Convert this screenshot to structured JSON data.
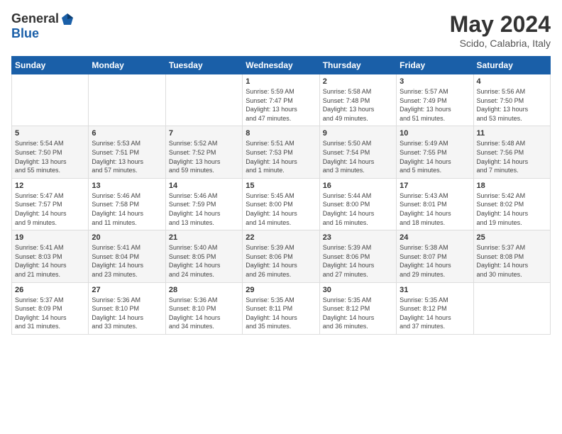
{
  "header": {
    "logo_general": "General",
    "logo_blue": "Blue",
    "month_year": "May 2024",
    "location": "Scido, Calabria, Italy"
  },
  "weekdays": [
    "Sunday",
    "Monday",
    "Tuesday",
    "Wednesday",
    "Thursday",
    "Friday",
    "Saturday"
  ],
  "weeks": [
    [
      {
        "day": "",
        "info": ""
      },
      {
        "day": "",
        "info": ""
      },
      {
        "day": "",
        "info": ""
      },
      {
        "day": "1",
        "info": "Sunrise: 5:59 AM\nSunset: 7:47 PM\nDaylight: 13 hours\nand 47 minutes."
      },
      {
        "day": "2",
        "info": "Sunrise: 5:58 AM\nSunset: 7:48 PM\nDaylight: 13 hours\nand 49 minutes."
      },
      {
        "day": "3",
        "info": "Sunrise: 5:57 AM\nSunset: 7:49 PM\nDaylight: 13 hours\nand 51 minutes."
      },
      {
        "day": "4",
        "info": "Sunrise: 5:56 AM\nSunset: 7:50 PM\nDaylight: 13 hours\nand 53 minutes."
      }
    ],
    [
      {
        "day": "5",
        "info": "Sunrise: 5:54 AM\nSunset: 7:50 PM\nDaylight: 13 hours\nand 55 minutes."
      },
      {
        "day": "6",
        "info": "Sunrise: 5:53 AM\nSunset: 7:51 PM\nDaylight: 13 hours\nand 57 minutes."
      },
      {
        "day": "7",
        "info": "Sunrise: 5:52 AM\nSunset: 7:52 PM\nDaylight: 13 hours\nand 59 minutes."
      },
      {
        "day": "8",
        "info": "Sunrise: 5:51 AM\nSunset: 7:53 PM\nDaylight: 14 hours\nand 1 minute."
      },
      {
        "day": "9",
        "info": "Sunrise: 5:50 AM\nSunset: 7:54 PM\nDaylight: 14 hours\nand 3 minutes."
      },
      {
        "day": "10",
        "info": "Sunrise: 5:49 AM\nSunset: 7:55 PM\nDaylight: 14 hours\nand 5 minutes."
      },
      {
        "day": "11",
        "info": "Sunrise: 5:48 AM\nSunset: 7:56 PM\nDaylight: 14 hours\nand 7 minutes."
      }
    ],
    [
      {
        "day": "12",
        "info": "Sunrise: 5:47 AM\nSunset: 7:57 PM\nDaylight: 14 hours\nand 9 minutes."
      },
      {
        "day": "13",
        "info": "Sunrise: 5:46 AM\nSunset: 7:58 PM\nDaylight: 14 hours\nand 11 minutes."
      },
      {
        "day": "14",
        "info": "Sunrise: 5:46 AM\nSunset: 7:59 PM\nDaylight: 14 hours\nand 13 minutes."
      },
      {
        "day": "15",
        "info": "Sunrise: 5:45 AM\nSunset: 8:00 PM\nDaylight: 14 hours\nand 14 minutes."
      },
      {
        "day": "16",
        "info": "Sunrise: 5:44 AM\nSunset: 8:00 PM\nDaylight: 14 hours\nand 16 minutes."
      },
      {
        "day": "17",
        "info": "Sunrise: 5:43 AM\nSunset: 8:01 PM\nDaylight: 14 hours\nand 18 minutes."
      },
      {
        "day": "18",
        "info": "Sunrise: 5:42 AM\nSunset: 8:02 PM\nDaylight: 14 hours\nand 19 minutes."
      }
    ],
    [
      {
        "day": "19",
        "info": "Sunrise: 5:41 AM\nSunset: 8:03 PM\nDaylight: 14 hours\nand 21 minutes."
      },
      {
        "day": "20",
        "info": "Sunrise: 5:41 AM\nSunset: 8:04 PM\nDaylight: 14 hours\nand 23 minutes."
      },
      {
        "day": "21",
        "info": "Sunrise: 5:40 AM\nSunset: 8:05 PM\nDaylight: 14 hours\nand 24 minutes."
      },
      {
        "day": "22",
        "info": "Sunrise: 5:39 AM\nSunset: 8:06 PM\nDaylight: 14 hours\nand 26 minutes."
      },
      {
        "day": "23",
        "info": "Sunrise: 5:39 AM\nSunset: 8:06 PM\nDaylight: 14 hours\nand 27 minutes."
      },
      {
        "day": "24",
        "info": "Sunrise: 5:38 AM\nSunset: 8:07 PM\nDaylight: 14 hours\nand 29 minutes."
      },
      {
        "day": "25",
        "info": "Sunrise: 5:37 AM\nSunset: 8:08 PM\nDaylight: 14 hours\nand 30 minutes."
      }
    ],
    [
      {
        "day": "26",
        "info": "Sunrise: 5:37 AM\nSunset: 8:09 PM\nDaylight: 14 hours\nand 31 minutes."
      },
      {
        "day": "27",
        "info": "Sunrise: 5:36 AM\nSunset: 8:10 PM\nDaylight: 14 hours\nand 33 minutes."
      },
      {
        "day": "28",
        "info": "Sunrise: 5:36 AM\nSunset: 8:10 PM\nDaylight: 14 hours\nand 34 minutes."
      },
      {
        "day": "29",
        "info": "Sunrise: 5:35 AM\nSunset: 8:11 PM\nDaylight: 14 hours\nand 35 minutes."
      },
      {
        "day": "30",
        "info": "Sunrise: 5:35 AM\nSunset: 8:12 PM\nDaylight: 14 hours\nand 36 minutes."
      },
      {
        "day": "31",
        "info": "Sunrise: 5:35 AM\nSunset: 8:12 PM\nDaylight: 14 hours\nand 37 minutes."
      },
      {
        "day": "",
        "info": ""
      }
    ]
  ]
}
